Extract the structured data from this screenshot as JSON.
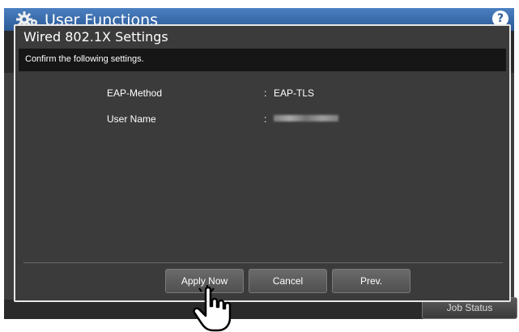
{
  "app": {
    "title": "User Functions",
    "help_label": "?"
  },
  "dialog": {
    "title": "Wired 802.1X Settings",
    "message": "Confirm the following settings.",
    "settings": [
      {
        "label": "EAP-Method",
        "separator": ":",
        "value": "EAP-TLS"
      },
      {
        "label": "User Name",
        "separator": ":",
        "value": ""
      }
    ],
    "buttons": {
      "apply": "Apply Now",
      "cancel": "Cancel",
      "prev": "Prev."
    }
  },
  "footer": {
    "job_status": "Job Status"
  },
  "colors": {
    "title_bar": "#2c5a96",
    "dialog_bg": "#3b3b3b",
    "confirm_bar": "#161616"
  }
}
